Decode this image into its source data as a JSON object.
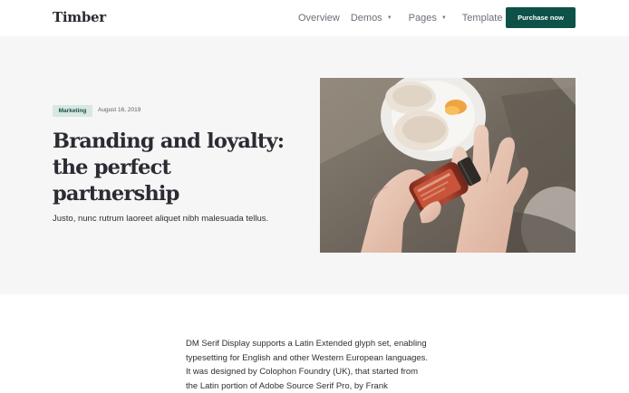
{
  "header": {
    "logo": "Timber",
    "nav": {
      "overview": "Overview",
      "demos": "Demos",
      "pages": "Pages",
      "template": "Template"
    },
    "caret_glyph": "▼",
    "purchase_label": "Purchase now"
  },
  "hero": {
    "tag": "Marketing",
    "date": "August 16, 2019",
    "title_lines": [
      "Branding and loyalty:",
      "the perfect",
      "partnership"
    ],
    "lead": "Justo, nunc rutrum laoreet aliquet nibh malesuada tellus.",
    "image_icon": "photo-hands-holding-supplement-bottle"
  },
  "article": {
    "lines": [
      "DM Serif Display supports a Latin Extended glyph set, enabling",
      "typesetting for English and other Western European languages.",
      "It was designed by Colophon Foundry (UK), that started from",
      "the Latin portion of Adobe Source Serif Pro, by Frank"
    ]
  },
  "colors": {
    "brand": "#0d5149",
    "hero_background": "#f6f6f6",
    "tag_background": "#d6e8e2",
    "text": "#2b2b33"
  }
}
